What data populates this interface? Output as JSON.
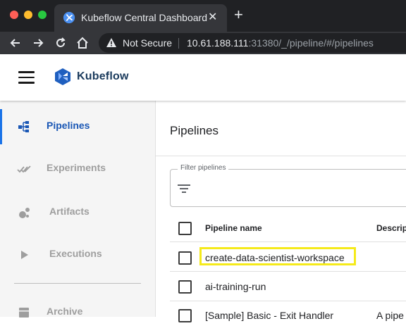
{
  "browser": {
    "tab_title": "Kubeflow Central Dashboard",
    "tab_close": "✕",
    "new_tab": "+",
    "security_label": "Not Secure",
    "url_host": "10.61.188.111",
    "url_rest": ":31380/_/pipeline/#/pipelines"
  },
  "header": {
    "brand": "Kubeflow"
  },
  "sidebar": {
    "items": [
      {
        "label": "Pipelines",
        "icon": "pipelines-icon",
        "active": true
      },
      {
        "label": "Experiments",
        "icon": "experiments-icon"
      },
      {
        "label": "Artifacts",
        "icon": "artifacts-icon"
      },
      {
        "label": "Executions",
        "icon": "executions-icon"
      },
      {
        "label": "Archive",
        "icon": "archive-icon"
      }
    ]
  },
  "main": {
    "title": "Pipelines",
    "filter_label": "Filter pipelines",
    "columns": [
      "Pipeline name",
      "Descrip"
    ],
    "rows": [
      {
        "name": "create-data-scientist-workspace",
        "description": "",
        "highlighted": true
      },
      {
        "name": "ai-training-run",
        "description": ""
      },
      {
        "name": "[Sample] Basic - Exit Handler",
        "description": "A pipe"
      }
    ]
  },
  "colors": {
    "accent": "#1a57b5",
    "highlight": "#f5ea1a",
    "chrome_dark": "#202124"
  }
}
